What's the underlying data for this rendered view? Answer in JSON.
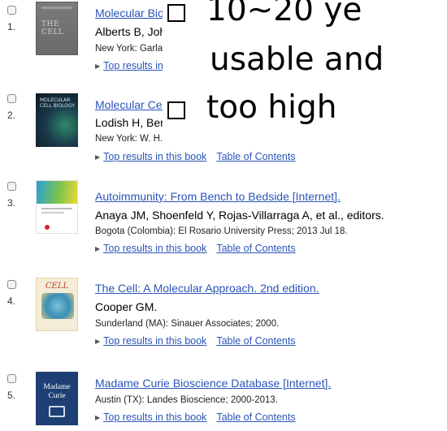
{
  "results": [
    {
      "num": "1.",
      "title": "Molecular Biolo",
      "authors": "Alberts B, Johns",
      "publication": "New York: Garlanc",
      "link1": "Top results in th",
      "link2": "",
      "thumb_icon": "book-cover-the-cell-icon",
      "thumb_label": "THE CELL"
    },
    {
      "num": "2.",
      "title": "Molecular Cell",
      "authors": "Lodish H, Berk",
      "publication": "New York: W. H. F",
      "link1": "Top results in this book",
      "link2": "Table of Contents",
      "thumb_icon": "book-cover-molecular-cell-biology-icon",
      "thumb_label": "MOLECULAR CELL BIOLOGY"
    },
    {
      "num": "3.",
      "title": "Autoimmunity: From Bench to Bedside [Internet].",
      "authors": "Anaya JM, Shoenfeld Y, Rojas-Villarraga A, et al., editors.",
      "publication": "Bogota (Colombia): El Rosario University Press; 2013 Jul 18.",
      "link1": "Top results in this book",
      "link2": "Table of Contents",
      "thumb_icon": "book-cover-autoimmunity-icon"
    },
    {
      "num": "4.",
      "title": "The Cell: A Molecular Approach. 2nd edition.",
      "authors": "Cooper GM.",
      "publication": "Sunderland (MA): Sinauer Associates; 2000.",
      "link1": "Top results in this book",
      "link2": "Table of Contents",
      "thumb_icon": "book-cover-the-cell-molecular-approach-icon",
      "thumb_label": "CELL"
    },
    {
      "num": "5.",
      "title": "Madame Curie Bioscience Database [Internet].",
      "authors": "",
      "publication": "Austin (TX): Landes Bioscience; 2000-2013.",
      "link1": "Top results in this book",
      "link2": "Table of Contents",
      "thumb_icon": "book-cover-madame-curie-icon",
      "thumb_label": "Madame Curie"
    }
  ],
  "overlay": {
    "bullets": [
      {
        "text": "10~20 ye"
      },
      {
        "text": "usable and"
      },
      {
        "text": "too high"
      }
    ]
  }
}
